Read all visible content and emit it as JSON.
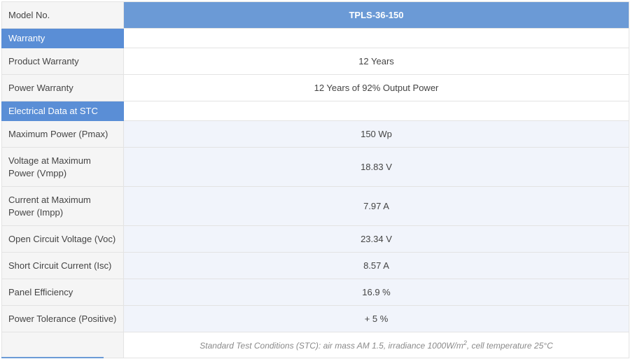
{
  "model": {
    "label": "Model No.",
    "value": "TPLS-36-150"
  },
  "sections": {
    "warranty": "Warranty",
    "electrical": "Electrical Data at STC"
  },
  "warranty_rows": [
    {
      "label": "Product Warranty",
      "value": "12 Years"
    },
    {
      "label": "Power Warranty",
      "value": "12 Years of 92% Output Power"
    }
  ],
  "electrical_rows": [
    {
      "label": "Maximum Power (Pmax)",
      "value": "150 Wp"
    },
    {
      "label": "Voltage at Maximum Power (Vmpp)",
      "value": "18.83 V"
    },
    {
      "label": "Current at Maximum Power (Impp)",
      "value": "7.97 A"
    },
    {
      "label": "Open Circuit Voltage (Voc)",
      "value": "23.34 V"
    },
    {
      "label": "Short Circuit Current (Isc)",
      "value": "8.57 A"
    },
    {
      "label": "Panel Efficiency",
      "value": "16.9 %"
    },
    {
      "label": "Power Tolerance (Positive)",
      "value": "+ 5 %"
    }
  ],
  "footnote": {
    "before": "Standard Test Conditions (STC): air mass AM 1.5, irradiance 1000W/m",
    "sup": "2",
    "after": ", cell temperature 25°C"
  },
  "colors": {
    "header_blue": "#6b9ad6",
    "section_blue": "#5a8ed6",
    "label_bg": "#f5f5f5",
    "alt_row_bg": "#f1f4fb"
  }
}
